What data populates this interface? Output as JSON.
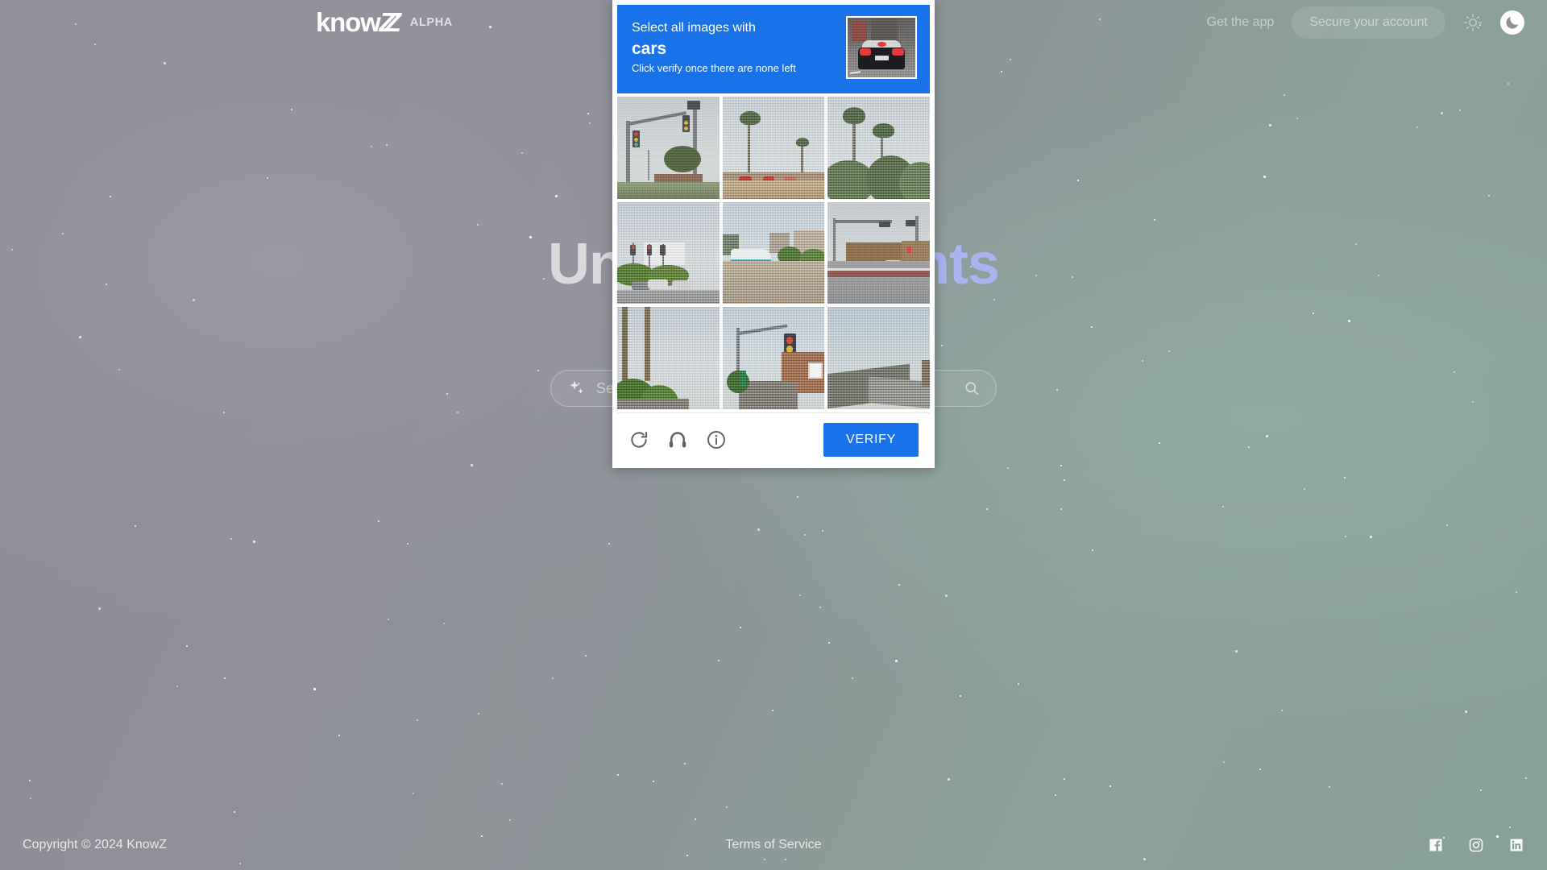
{
  "nav": {
    "logo_text": "know",
    "logo_mark": "Z",
    "alpha_badge": "ALPHA",
    "get_app": "Get the app",
    "secure_account": "Secure your account",
    "light_icon": "sun-icon",
    "dark_icon": "moon-icon"
  },
  "hero": {
    "headline_part1": "Unleash in",
    "headline_part2": "sights",
    "full_headline": "Unleash insights"
  },
  "search": {
    "sparkle_icon": "sparkle-icon",
    "placeholder": "Search for secrets",
    "value": "Search for secrets",
    "magnifier_icon": "search-icon"
  },
  "captcha": {
    "instruction": "Select all images with",
    "target": "cars",
    "hint": "Click verify once there are none left",
    "example_alt": "car-rear-view-example",
    "reload_icon": "reload-icon",
    "audio_icon": "headphones-icon",
    "info_icon": "info-icon",
    "verify_label": "VERIFY",
    "accent_color": "#1a73e8",
    "tiles": [
      {
        "id": 1,
        "alt": "traffic-light-overhead-gray-sky",
        "selected": false
      },
      {
        "id": 2,
        "alt": "palm-tree-and-storefronts",
        "selected": false
      },
      {
        "id": 3,
        "alt": "two-palm-trees-over-hedge",
        "selected": false
      },
      {
        "id": 4,
        "alt": "intersection-with-parked-cars",
        "selected": false
      },
      {
        "id": 5,
        "alt": "street-market-with-white-car",
        "selected": false
      },
      {
        "id": 6,
        "alt": "road-with-moving-cars",
        "selected": false
      },
      {
        "id": 7,
        "alt": "two-palm-trunks-close-up",
        "selected": false
      },
      {
        "id": 8,
        "alt": "traffic-light-beside-brick-house",
        "selected": false
      },
      {
        "id": 9,
        "alt": "rooftop-against-sky",
        "selected": false
      }
    ]
  },
  "footer": {
    "copyright": "Copyright © 2024 KnowZ",
    "terms": "Terms of Service",
    "social": [
      {
        "name": "facebook-icon"
      },
      {
        "name": "instagram-icon"
      },
      {
        "name": "linkedin-icon"
      }
    ]
  },
  "theme": {
    "accent": "#1a73e8",
    "bg_left": "#8e8d95",
    "bg_right": "#86a099",
    "hero_color_1": "#d9dade",
    "hero_color_2": "#a9b4f0"
  }
}
